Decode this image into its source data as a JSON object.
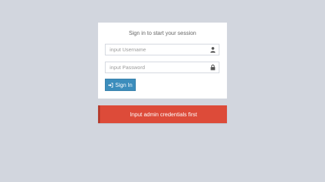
{
  "login": {
    "message": "Sign in to start your session",
    "username": {
      "placeholder": "input Username",
      "value": "",
      "icon": "user-icon"
    },
    "password": {
      "placeholder": "input Password",
      "value": "",
      "icon": "lock-icon"
    },
    "signin_label": "Sign In",
    "signin_icon": "sign-in-icon"
  },
  "alert": {
    "text": "Input admin credentials first",
    "color": "#dd4b39"
  },
  "colors": {
    "background": "#d2d6de",
    "primary": "#3c8dbc",
    "danger": "#dd4b39"
  }
}
